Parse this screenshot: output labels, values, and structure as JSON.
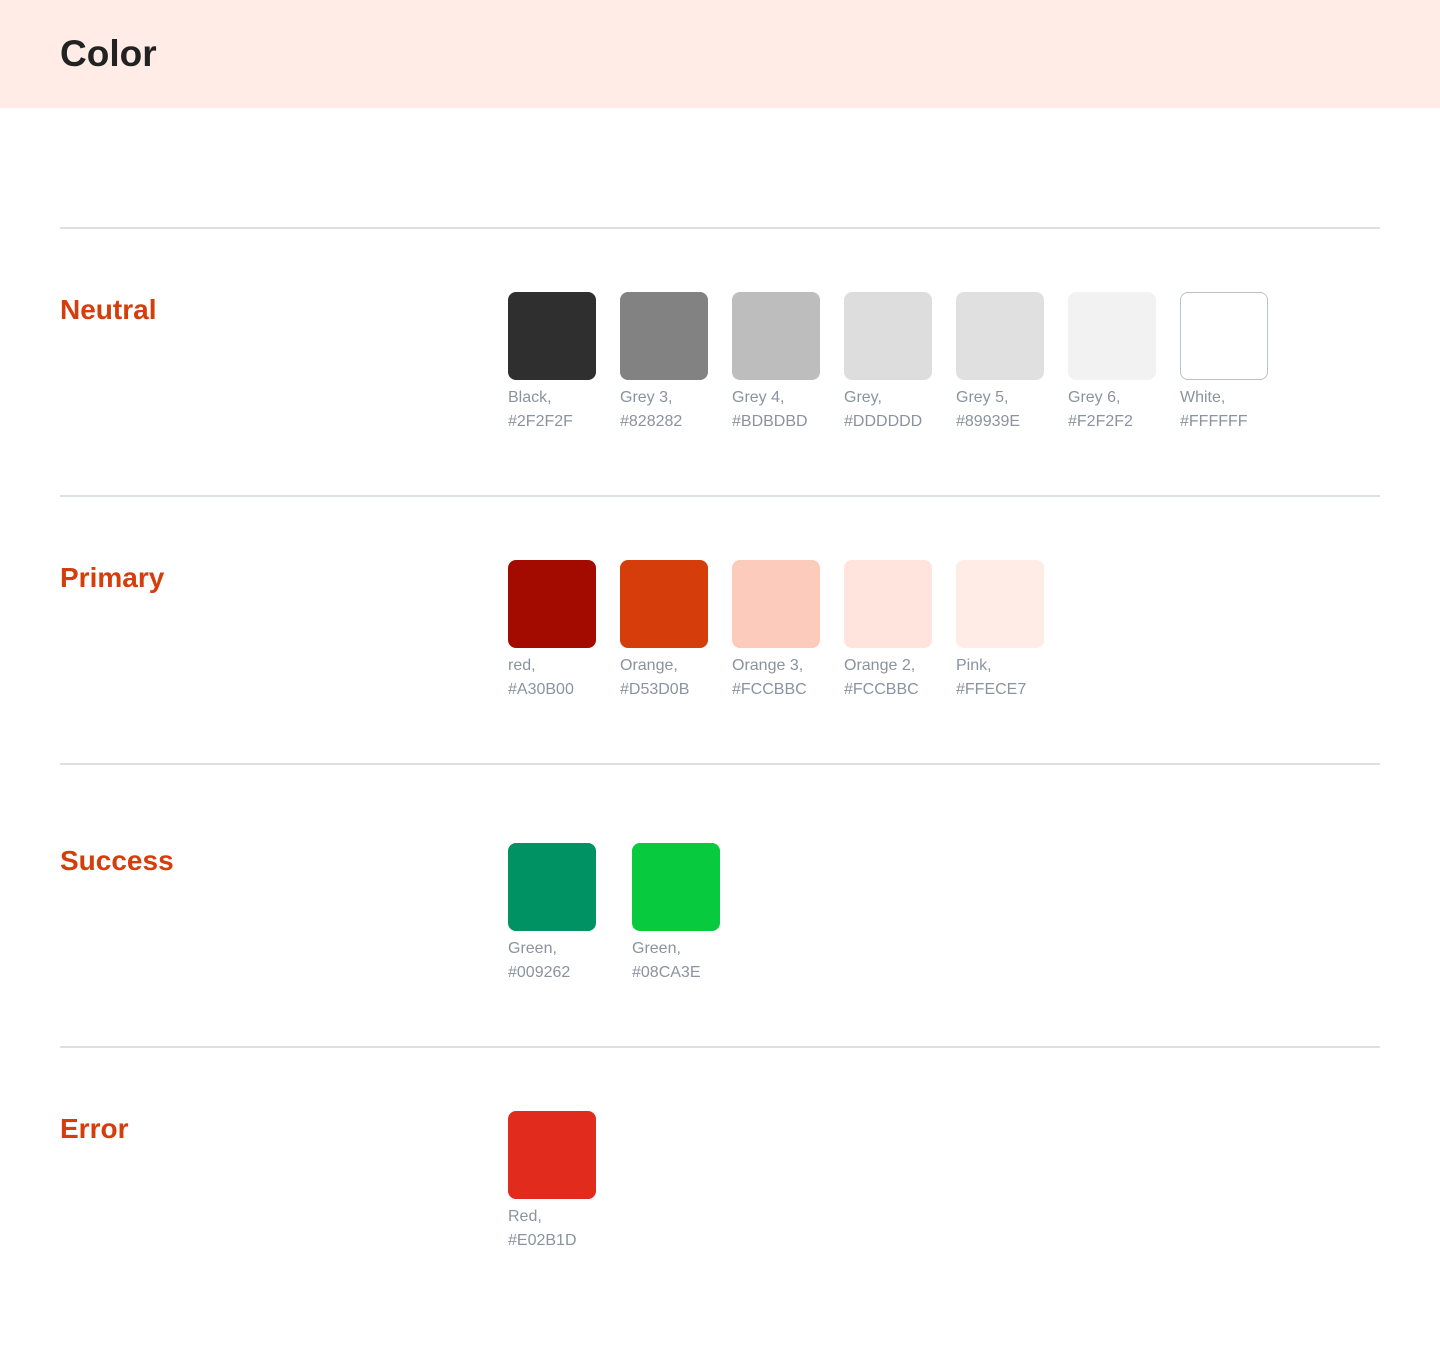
{
  "page": {
    "title": "Color"
  },
  "sections": [
    {
      "title": "Neutral",
      "swatches": [
        {
          "name": "Black,",
          "hex": "#2F2F2F",
          "color": "#2F2F2F"
        },
        {
          "name": "Grey 3,",
          "hex": "#828282",
          "color": "#828282"
        },
        {
          "name": "Grey 4,",
          "hex": "#BDBDBD",
          "color": "#BDBDBD"
        },
        {
          "name": "Grey,",
          "hex": "#DDDDDD",
          "color": "#DDDDDD"
        },
        {
          "name": "Grey 5,",
          "hex": "#89939E",
          "color": "#E0E0E0"
        },
        {
          "name": "Grey 6,",
          "hex": "#F2F2F2",
          "color": "#F2F2F2"
        },
        {
          "name": "White,",
          "hex": "#FFFFFF",
          "color": "#FFFFFF"
        }
      ]
    },
    {
      "title": "Primary",
      "swatches": [
        {
          "name": "red,",
          "hex": "#A30B00",
          "color": "#A30B00"
        },
        {
          "name": "Orange,",
          "hex": "#D53D0B",
          "color": "#D53D0B"
        },
        {
          "name": "Orange 3,",
          "hex": "#FCCBBC",
          "color": "#FCCBBC"
        },
        {
          "name": "Orange 2,",
          "hex": "#FCCBBC",
          "color": "#FFE3DC"
        },
        {
          "name": "Pink,",
          "hex": "#FFECE7",
          "color": "#FFECE7"
        }
      ]
    },
    {
      "title": "Success",
      "swatches": [
        {
          "name": "Green,",
          "hex": "#009262",
          "color": "#009262"
        },
        {
          "name": "Green,",
          "hex": "#08CA3E",
          "color": "#08CA3E"
        }
      ]
    },
    {
      "title": "Error",
      "swatches": [
        {
          "name": "Red,",
          "hex": "#E02B1D",
          "color": "#E02B1D"
        }
      ]
    }
  ]
}
